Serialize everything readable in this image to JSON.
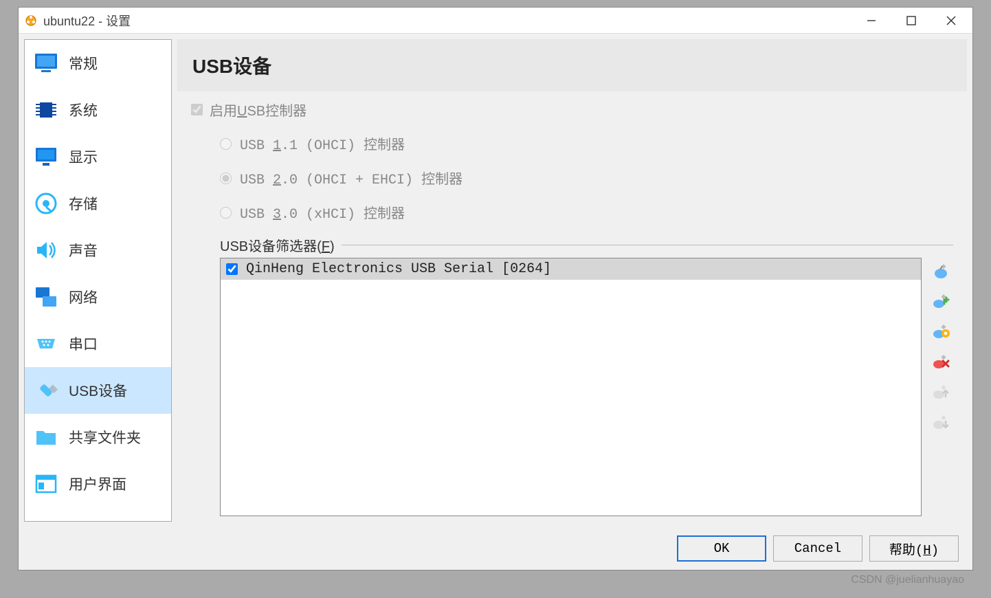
{
  "window": {
    "title": "ubuntu22 - 设置"
  },
  "sidebar": {
    "items": [
      {
        "label": "常规",
        "icon": "general"
      },
      {
        "label": "系统",
        "icon": "system"
      },
      {
        "label": "显示",
        "icon": "display"
      },
      {
        "label": "存储",
        "icon": "storage"
      },
      {
        "label": "声音",
        "icon": "audio"
      },
      {
        "label": "网络",
        "icon": "network"
      },
      {
        "label": "串口",
        "icon": "serial"
      },
      {
        "label": "USB设备",
        "icon": "usb"
      },
      {
        "label": "共享文件夹",
        "icon": "shared"
      },
      {
        "label": "用户界面",
        "icon": "ui"
      }
    ],
    "selected_index": 7
  },
  "main": {
    "title": "USB设备",
    "enable_usb_label_pre": "启用",
    "enable_usb_label_u": "U",
    "enable_usb_label_suf": "SB控制器",
    "radio": {
      "usb11_pre": "USB ",
      "usb11_u": "1",
      "usb11_suf": ".1 (OHCI) 控制器",
      "usb20_pre": "USB ",
      "usb20_u": "2",
      "usb20_suf": ".0 (OHCI + EHCI) 控制器",
      "usb30_pre": "USB ",
      "usb30_u": "3",
      "usb30_suf": ".0 (xHCI) 控制器"
    },
    "filter_label_pre": "USB设备筛选器(",
    "filter_label_u": "F",
    "filter_label_suf": ")",
    "filters": [
      {
        "checked": true,
        "label": "QinHeng Electronics USB Serial [0264]"
      }
    ]
  },
  "footer": {
    "ok_label": "OK",
    "cancel_label": "Cancel",
    "help_label_pre": "帮助(",
    "help_label_u": "H",
    "help_label_suf": ")"
  },
  "watermark": "CSDN @juelianhuayao"
}
